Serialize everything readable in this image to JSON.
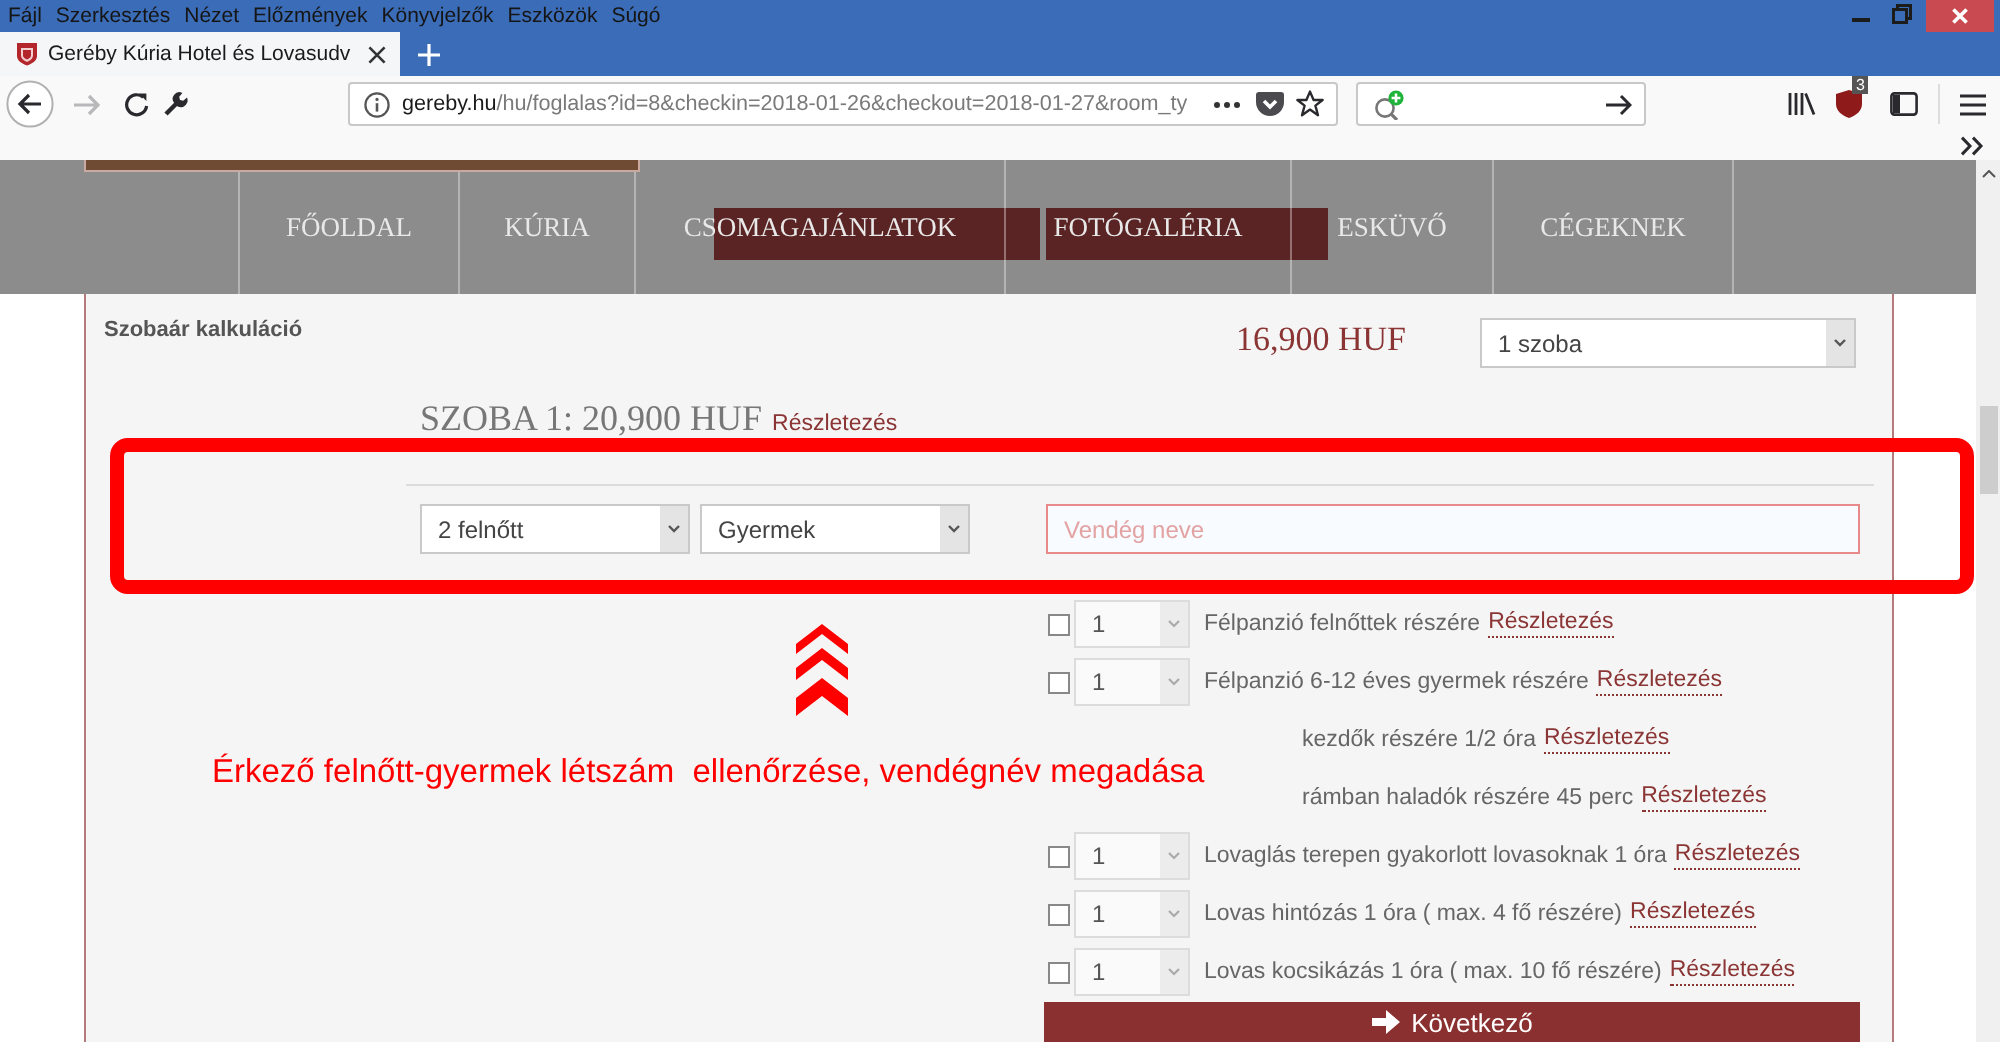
{
  "menu_bar": {
    "items": [
      "Fájl",
      "Szerkesztés",
      "Nézet",
      "Előzmények",
      "Könyvjelzők",
      "Eszközök",
      "Súgó"
    ]
  },
  "tabs": [
    {
      "title": "Geréby Kúria Hotel és Lovasudv",
      "selected": true
    }
  ],
  "toolbar": {
    "forward_disabled": true,
    "url_host": "gereby.hu",
    "url_path": "/hu/foglalas?id=8&checkin=2018-01-26&checkout=2018-01-27&room_ty",
    "extension_badge": "3"
  },
  "site_nav": {
    "items": [
      "FŐOLDAL",
      "KÚRIA",
      "CSOMAGAJÁNLATOK",
      "FOTÓGALÉRIA",
      "ESKÜVŐ",
      "CÉGEKNEK"
    ]
  },
  "booking": {
    "title": "Szobaár kalkuláció",
    "price": "16,900 HUF",
    "rooms_select": "1 szoba",
    "room_heading": "SZOBA 1: 20,900 HUF",
    "room_details_link": "Részletezés",
    "adults_select": "2 felnőtt",
    "children_select": "Gyermek",
    "guest_name": {
      "placeholder": "Vendég neve"
    },
    "services": [
      {
        "kind": "full",
        "checked": false,
        "quantity": "1",
        "label": "Félpanzió felnőttek részére",
        "link": "Részletezés"
      },
      {
        "kind": "full",
        "checked": false,
        "quantity": "1",
        "label": "Félpanzió 6-12 éves gyermek részére",
        "link": "Részletezés"
      },
      {
        "kind": "covered",
        "label": "kezdők részére 1/2 óra",
        "link": "Részletezés"
      },
      {
        "kind": "covered",
        "label": "rámban haladók részére 45 perc",
        "link": "Részletezés"
      },
      {
        "kind": "full",
        "checked": false,
        "quantity": "1",
        "label": "Lovaglás terepen gyakorlott lovasoknak 1 óra",
        "link": "Részletezés"
      },
      {
        "kind": "full",
        "checked": false,
        "quantity": "1",
        "label": "Lovas hintózás 1 óra ( max. 4 fő részére)",
        "link": "Részletezés"
      },
      {
        "kind": "full",
        "checked": false,
        "quantity": "1",
        "label": "Lovas kocsikázás 1 óra ( max. 10 fő részére)",
        "link": "Részletezés"
      }
    ],
    "next_button": "Következő"
  },
  "annotation": {
    "text": "Érkező felnőtt-gyermek létszám  ellenőrzése, vendégnév megadása"
  }
}
